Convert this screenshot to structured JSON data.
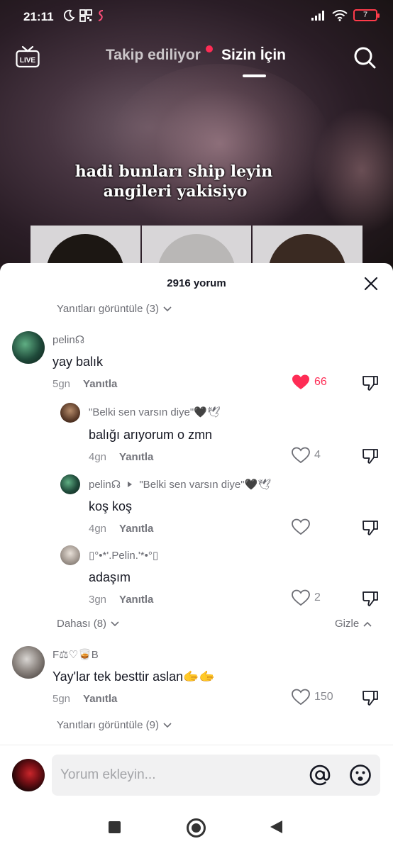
{
  "status_bar": {
    "time": "21:11",
    "battery": "7"
  },
  "top_nav": {
    "live_label": "LIVE",
    "tab_following": "Takip ediliyor",
    "tab_for_you": "Sizin İçin"
  },
  "video": {
    "caption_line1": "hadi bunları ship leyin",
    "caption_line2": "angileri yakisiyo"
  },
  "comments_sheet": {
    "title": "2916 yorum",
    "view_replies_top": "Yanıtları görüntüle (3)",
    "comments": [
      {
        "username": "pelin☊",
        "text": "yay balık",
        "age": "5gn",
        "reply_label": "Yanıtla",
        "likes": "66",
        "liked": true,
        "replies": [
          {
            "username": "\"Belki sen varsın diye\"🖤🕊",
            "text": "balığı arıyorum o zmn",
            "age": "4gn",
            "reply_label": "Yanıtla",
            "likes": "4"
          },
          {
            "username": "pelin☊",
            "reply_to": "\"Belki sen varsın diye\"🖤🕊",
            "text": "koş koş",
            "age": "4gn",
            "reply_label": "Yanıtla",
            "likes": ""
          },
          {
            "username": "▯°•*'.Pelin.'*•°▯",
            "text": "adaşım",
            "age": "3gn",
            "reply_label": "Yanıtla",
            "likes": "2"
          }
        ],
        "more_label": "Dahası (8)",
        "hide_label": "Gizle"
      },
      {
        "username": "F⚖♡🥃B",
        "text": "Yay'lar tek besttir aslan🫱🫱",
        "age": "5gn",
        "reply_label": "Yanıtla",
        "likes": "150",
        "liked": false,
        "view_replies": "Yanıtları görüntüle (9)"
      }
    ]
  },
  "input": {
    "placeholder": "Yorum ekleyin..."
  },
  "colors": {
    "accent": "#fe2c55",
    "text": "#161823",
    "muted": "#8a8b91"
  }
}
